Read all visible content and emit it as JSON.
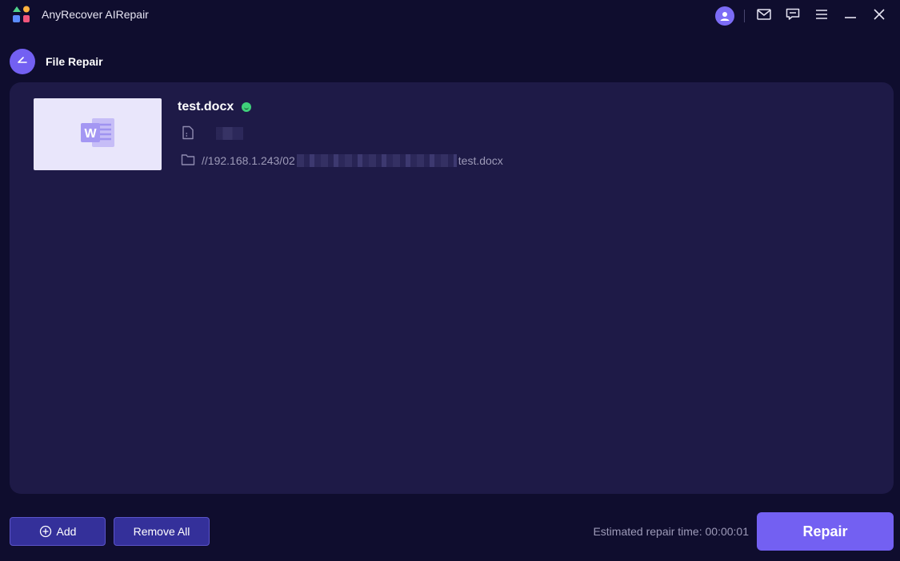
{
  "app": {
    "title": "AnyRecover AIRepair"
  },
  "titlebar": {
    "icons": [
      "account-icon",
      "mail-icon",
      "feedback-icon",
      "menu-icon",
      "minimize-icon",
      "close-icon"
    ]
  },
  "header": {
    "title": "File Repair",
    "back_icon": "back-arrow-icon"
  },
  "files": [
    {
      "name": "test.docx",
      "status": "ok",
      "status_color": "#3fd07a",
      "size_icon": "document-icon",
      "folder_icon": "folder-icon",
      "path_prefix": "//192.168.1.243/02",
      "path_suffix": "test.docx",
      "thumbnail_icon": "word-icon"
    }
  ],
  "footer": {
    "add_label": "Add",
    "remove_all_label": "Remove All",
    "estimate_label": "Estimated repair time: 00:00:01",
    "repair_label": "Repair"
  },
  "colors": {
    "background": "#0f0d2e",
    "panel": "#1e1a47",
    "accent": "#7360f2",
    "secondary_button": "#34309a"
  }
}
